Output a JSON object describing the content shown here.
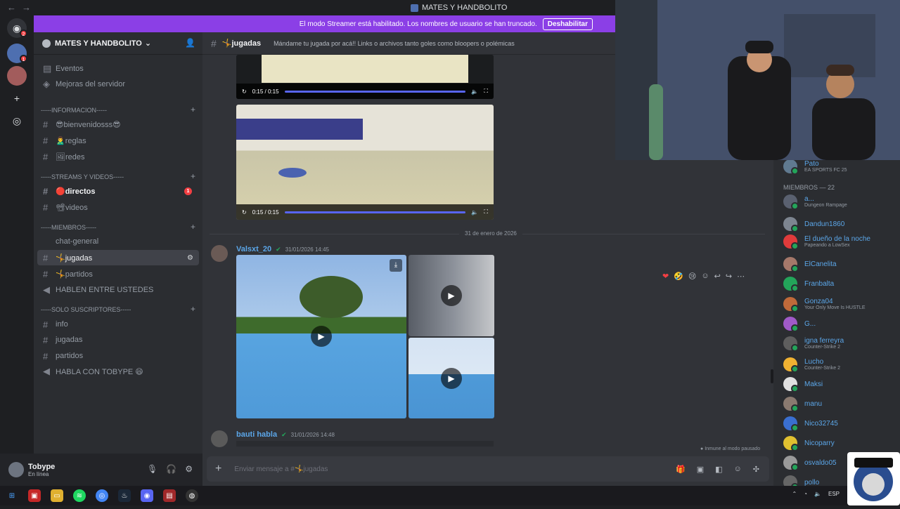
{
  "window": {
    "title": "MATES Y HANDBOLITO"
  },
  "banner": {
    "text": "El modo Streamer está habilitado. Los nombres de usuario se han truncado.",
    "button": "Deshabilitar"
  },
  "rail": {
    "home_badge": "2",
    "server1_badge": "1"
  },
  "server": {
    "name": "MATES Y HANDBOLITO"
  },
  "sidebar": {
    "top_items": [
      "Eventos",
      "Mejoras del servidor"
    ],
    "categories": [
      {
        "name": "-----INFORMACION-----",
        "channels": [
          "😎bienvenidosss😎",
          "🙎‍♂️reglas",
          "🖼redes"
        ]
      },
      {
        "name": "-----STREAMS Y VIDEOS-----",
        "channels": [
          "🔴directos",
          "📽videos"
        ]
      },
      {
        "name": "-----MIEMBROS-----",
        "channels": [
          "chat-general",
          "🤸jugadas",
          "🤸partidos",
          "HABLEN ENTRE USTEDES"
        ]
      },
      {
        "name": "-----SOLO SUSCRIPTORES-----",
        "channels": [
          "info",
          "jugadas",
          "partidos",
          "HABLA CON TOBYPE 😄"
        ]
      }
    ],
    "directos_badge": "1"
  },
  "user": {
    "name": "Tobype",
    "status": "En línea"
  },
  "chat": {
    "channel": "🤸jugadas",
    "topic": "Mándame tu jugada por acá!! Links o archivos tanto goles como bloopers o polémicas",
    "video_time": "0:15 / 0:15",
    "date_divider": "31 de enero de 2026",
    "messages": [
      {
        "user": "Valsxt_20",
        "time": "31/01/2026 14:45"
      },
      {
        "user": "bauti habla",
        "time": "31/01/2026 14:48"
      }
    ],
    "pause_note": "Inmune al modo pausado",
    "composer_placeholder": "Enviar mensaje a #🤸jugadas"
  },
  "members": {
    "top_entry": {
      "name": "Pato",
      "activity": "EA SPORTS FC 25"
    },
    "header": "MIEMBROS — 22",
    "list": [
      {
        "name": "a...",
        "activity": "Dungeon Rampage",
        "color": "#5a6170"
      },
      {
        "name": "Dandun1860",
        "activity": "",
        "color": "#7d8590"
      },
      {
        "name": "El dueño de la noche",
        "activity": "Papeando a LowSex",
        "color": "#e03b3b"
      },
      {
        "name": "ElCanelita",
        "activity": "",
        "color": "#a5786a"
      },
      {
        "name": "Franbalta",
        "activity": "",
        "color": "#23a55a"
      },
      {
        "name": "Gonza04",
        "activity": "Your Only Move Is HUSTLE",
        "color": "#c06a3a"
      },
      {
        "name": "G...",
        "activity": "",
        "color": "#a05ac8"
      },
      {
        "name": "igna ferreyra",
        "activity": "Counter-Strike 2",
        "color": "#5e5e5e"
      },
      {
        "name": "Lucho",
        "activity": "Counter-Strike 2",
        "color": "#f0b232"
      },
      {
        "name": "Maksi",
        "activity": "",
        "color": "#e0e0e0"
      },
      {
        "name": "manu",
        "activity": "",
        "color": "#8a7a70"
      },
      {
        "name": "Nico32745",
        "activity": "",
        "color": "#3a6fd0"
      },
      {
        "name": "Nicoparry",
        "activity": "",
        "color": "#e0c030"
      },
      {
        "name": "osvaldo05",
        "activity": "",
        "color": "#9a9a9a"
      },
      {
        "name": "pollo",
        "activity": "",
        "color": "#666"
      }
    ]
  },
  "taskbar": {
    "lang": "ESP"
  },
  "overlay": {
    "logo_text": "TEAM BRUTUS"
  }
}
